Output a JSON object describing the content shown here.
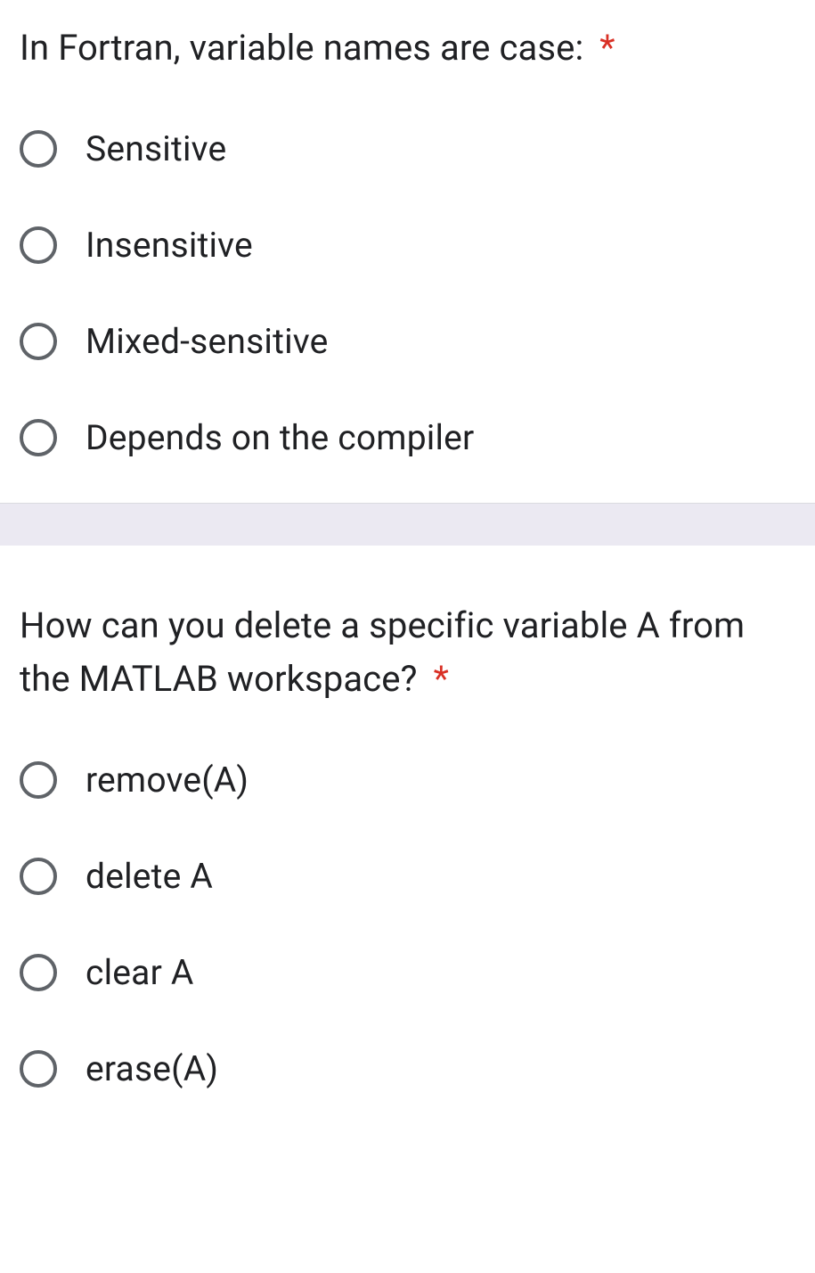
{
  "questions": [
    {
      "text": "In Fortran, variable names are case:",
      "required": "*",
      "options": [
        "Sensitive",
        "Insensitive",
        "Mixed-sensitive",
        "Depends on the compiler"
      ]
    },
    {
      "text": "How can you delete a specific variable A from the MATLAB workspace?",
      "required": "*",
      "options": [
        "remove(A)",
        "delete A",
        "clear A",
        "erase(A)"
      ]
    }
  ]
}
